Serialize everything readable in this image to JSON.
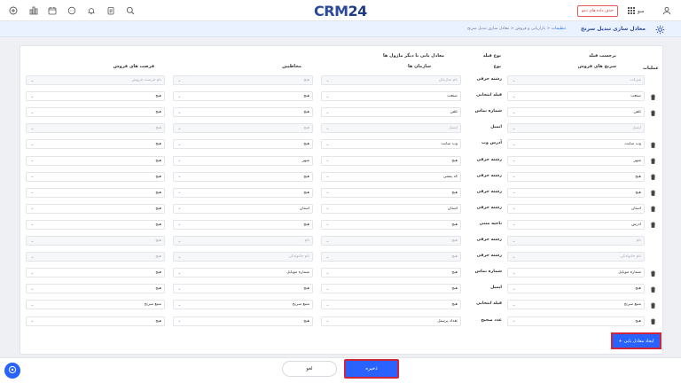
{
  "topbar": {
    "logo_crm": "CRM",
    "logo_24": "24",
    "delete_demo_label": "حذف داده های دمو",
    "user_name": "سو",
    "icons": [
      "plus-circle-icon",
      "dashboard-icon",
      "calendar-icon",
      "chat-icon",
      "bell-icon",
      "clipboard-icon",
      "search-icon"
    ]
  },
  "subbar": {
    "page_title": "معادل سازی تبدیل سرنخ",
    "breadcrumb_1": "تنظیمات",
    "breadcrumb_2": "بازاریابی و فروش",
    "breadcrumb_3": "معادل سازی تبدیل سرنخ",
    "separator": "<"
  },
  "table": {
    "col_actions": "عملیات",
    "col_field_label": "برچسب فیلد",
    "col_field_label_sub": "سرنخ های فروش",
    "col_field_type": "نوع فیلد",
    "col_field_type_sub": "نوع",
    "col_match_group": "معادل یابی با دیگر ماژول ها",
    "col_orgs": "سازمان ها",
    "col_contacts": "مخاطبین",
    "col_opps": "فرصت های فروش",
    "rows": [
      {
        "trash": false,
        "lead": "شرکت",
        "lead_dis": true,
        "type": "رشته حرفی",
        "org": "نام سازمان",
        "org_dis": true,
        "contact": "هیچ",
        "contact_dis": true,
        "opp": "نام فرصت فروش",
        "opp_dis": true
      },
      {
        "trash": true,
        "lead": "صنعت",
        "lead_dis": false,
        "type": "فیلد انتخابی",
        "org": "صنعت",
        "org_dis": false,
        "contact": "هیچ",
        "contact_dis": false,
        "opp": "هیچ",
        "opp_dis": false
      },
      {
        "trash": true,
        "lead": "تلفن",
        "lead_dis": false,
        "type": "شماره تماس",
        "org": "تلفن",
        "org_dis": false,
        "contact": "هیچ",
        "contact_dis": false,
        "opp": "هیچ",
        "opp_dis": false
      },
      {
        "trash": false,
        "lead": "ایمیل",
        "lead_dis": true,
        "type": "ایمیل",
        "org": "ایمیل",
        "org_dis": true,
        "contact": "هیچ",
        "contact_dis": true,
        "opp": "هیچ",
        "opp_dis": true
      },
      {
        "trash": true,
        "lead": "وب سایت",
        "lead_dis": false,
        "type": "آدرس وب",
        "org": "وب سایت",
        "org_dis": false,
        "contact": "هیچ",
        "contact_dis": false,
        "opp": "هیچ",
        "opp_dis": false
      },
      {
        "trash": true,
        "lead": "شهر",
        "lead_dis": false,
        "type": "رشته حرفی",
        "org": "هیچ",
        "org_dis": false,
        "contact": "شهر",
        "contact_dis": false,
        "opp": "هیچ",
        "opp_dis": false
      },
      {
        "trash": true,
        "lead": "هیچ",
        "lead_dis": false,
        "type": "رشته حرفی",
        "org": "کد پستی",
        "org_dis": false,
        "contact": "هیچ",
        "contact_dis": false,
        "opp": "هیچ",
        "opp_dis": false
      },
      {
        "trash": true,
        "lead": "هیچ",
        "lead_dis": false,
        "type": "رشته حرفی",
        "org": "هیچ",
        "org_dis": false,
        "contact": "هیچ",
        "contact_dis": false,
        "opp": "هیچ",
        "opp_dis": false
      },
      {
        "trash": true,
        "lead": "استان",
        "lead_dis": false,
        "type": "رشته حرفی",
        "org": "استان",
        "org_dis": false,
        "contact": "استان",
        "contact_dis": false,
        "opp": "هیچ",
        "opp_dis": false
      },
      {
        "trash": true,
        "lead": "آدرس",
        "lead_dis": false,
        "type": "ناحیه متنی",
        "org": "هیچ",
        "org_dis": false,
        "contact": "هیچ",
        "contact_dis": false,
        "opp": "هیچ",
        "opp_dis": false
      },
      {
        "trash": false,
        "lead": "نام",
        "lead_dis": true,
        "type": "رشته حرفی",
        "org": "هیچ",
        "org_dis": true,
        "contact": "نام",
        "contact_dis": true,
        "opp": "هیچ",
        "opp_dis": true
      },
      {
        "trash": false,
        "lead": "نام خانوادگی",
        "lead_dis": true,
        "type": "رشته حرفی",
        "org": "هیچ",
        "org_dis": true,
        "contact": "نام خانوادگی",
        "contact_dis": true,
        "opp": "هیچ",
        "opp_dis": true
      },
      {
        "trash": true,
        "lead": "شماره موبایل",
        "lead_dis": false,
        "type": "شماره تماس",
        "org": "هیچ",
        "org_dis": false,
        "contact": "شماره موبایل",
        "contact_dis": false,
        "opp": "هیچ",
        "opp_dis": false
      },
      {
        "trash": true,
        "lead": "هیچ",
        "lead_dis": false,
        "type": "ایمیل",
        "org": "هیچ",
        "org_dis": false,
        "contact": "هیچ",
        "contact_dis": false,
        "opp": "هیچ",
        "opp_dis": false
      },
      {
        "trash": true,
        "lead": "منبع سرنخ",
        "lead_dis": false,
        "type": "فیلد انتخابی",
        "org": "هیچ",
        "org_dis": false,
        "contact": "منبع سرنخ",
        "contact_dis": false,
        "opp": "منبع سرنخ",
        "opp_dis": false
      },
      {
        "trash": true,
        "lead": "هیچ",
        "lead_dis": false,
        "type": "عدد صحیح",
        "org": "تعداد پرسنل",
        "org_dis": false,
        "contact": "هیچ",
        "contact_dis": false,
        "opp": "هیچ",
        "opp_dis": false
      }
    ]
  },
  "actions": {
    "create_mapping_label": "ایجاد معادل یابی",
    "create_mapping_plus": "+",
    "save_label": "ذخیره",
    "cancel_label": "لغو"
  }
}
